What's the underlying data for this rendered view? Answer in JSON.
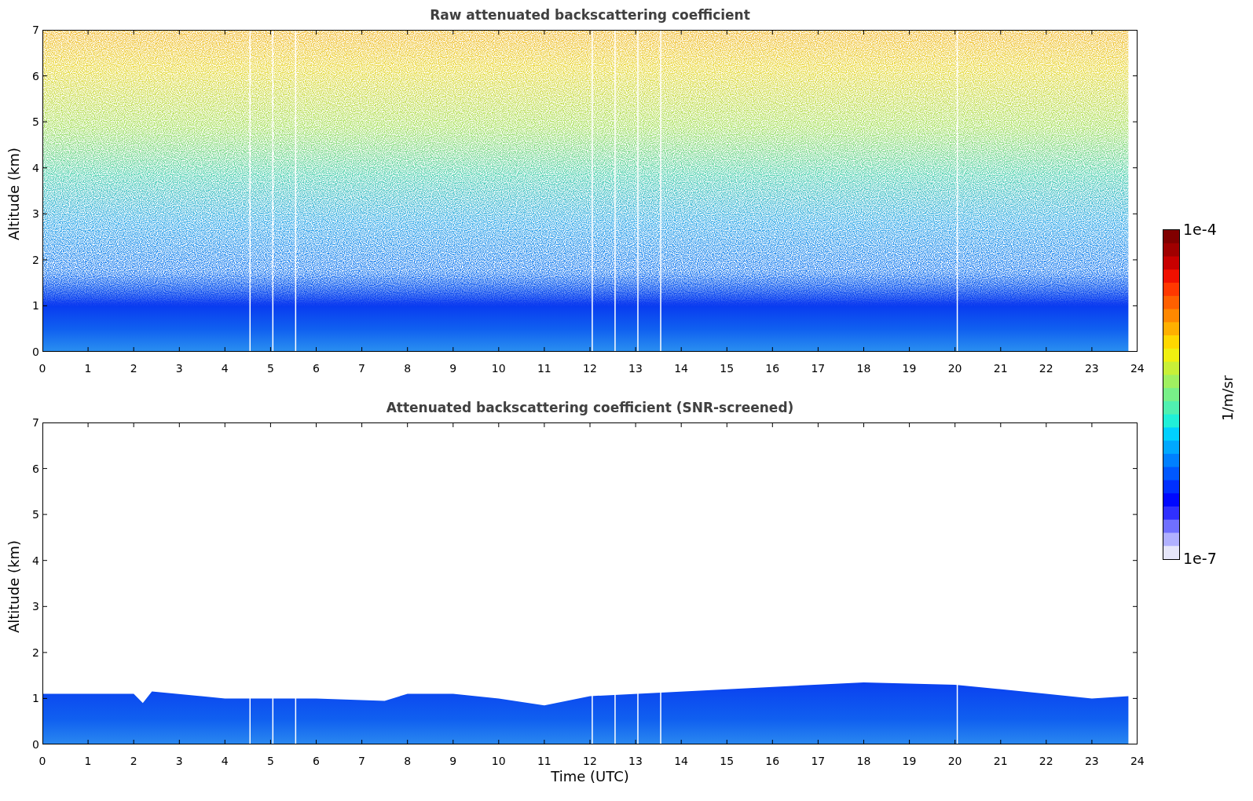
{
  "panels": [
    {
      "kind": "raw",
      "title": "Raw attenuated backscattering coefficient",
      "ylabel": "Altitude (km)",
      "yticks": [
        "7",
        "6",
        "5",
        "4",
        "3",
        "2",
        "1",
        "0"
      ],
      "xticks": [
        "0",
        "1",
        "2",
        "3",
        "4",
        "5",
        "6",
        "7",
        "8",
        "9",
        "10",
        "11",
        "12",
        "13",
        "14",
        "15",
        "16",
        "17",
        "18",
        "19",
        "20",
        "21",
        "22",
        "23",
        "24"
      ]
    },
    {
      "kind": "screened",
      "title": "Attenuated backscattering coefficient (SNR-screened)",
      "ylabel": "Altitude (km)",
      "yticks": [
        "7",
        "6",
        "5",
        "4",
        "3",
        "2",
        "1",
        "0"
      ],
      "xticks": [
        "0",
        "1",
        "2",
        "3",
        "4",
        "5",
        "6",
        "7",
        "8",
        "9",
        "10",
        "11",
        "12",
        "13",
        "14",
        "15",
        "16",
        "17",
        "18",
        "19",
        "20",
        "21",
        "22",
        "23",
        "24"
      ],
      "xlabel": "Time (UTC)"
    }
  ],
  "colorbar": {
    "max_label": "1e-4",
    "min_label": "1e-7",
    "unit": "1/m/sr"
  }
}
